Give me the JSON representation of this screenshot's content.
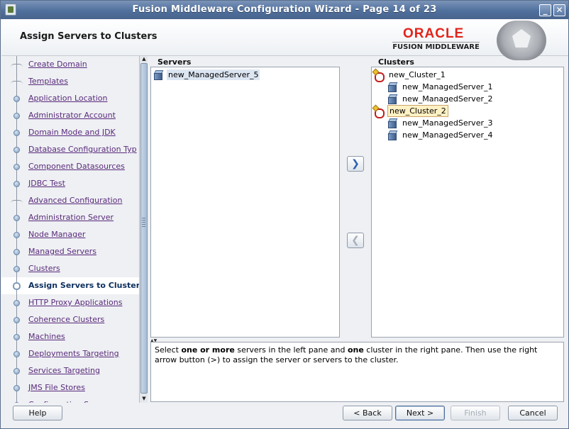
{
  "window": {
    "title": "Fusion Middleware Configuration Wizard - Page 14 of 23",
    "min_glyph": "_",
    "close_glyph": "✕"
  },
  "header": {
    "heading": "Assign Servers to Clusters",
    "brand_top": "ORACLE",
    "brand_bottom": "FUSION MIDDLEWARE"
  },
  "nav": {
    "items": [
      {
        "label": "Create Domain",
        "style": "flat"
      },
      {
        "label": "Templates",
        "style": "flat"
      },
      {
        "label": "Application Location",
        "style": "dot"
      },
      {
        "label": "Administrator Account",
        "style": "dot"
      },
      {
        "label": "Domain Mode and JDK",
        "style": "dot"
      },
      {
        "label": "Database Configuration Typ",
        "style": "dot"
      },
      {
        "label": "Component Datasources",
        "style": "dot"
      },
      {
        "label": "JDBC Test",
        "style": "dot"
      },
      {
        "label": "Advanced Configuration",
        "style": "flat"
      },
      {
        "label": "Administration Server",
        "style": "dot"
      },
      {
        "label": "Node Manager",
        "style": "dot"
      },
      {
        "label": "Managed Servers",
        "style": "dot"
      },
      {
        "label": "Clusters",
        "style": "dot"
      },
      {
        "label": "Assign Servers to Cluster",
        "style": "dot",
        "active": true
      },
      {
        "label": "HTTP Proxy Applications",
        "style": "dot"
      },
      {
        "label": "Coherence Clusters",
        "style": "dot"
      },
      {
        "label": "Machines",
        "style": "dot"
      },
      {
        "label": "Deployments Targeting",
        "style": "dot"
      },
      {
        "label": "Services Targeting",
        "style": "dot"
      },
      {
        "label": "JMS File Stores",
        "style": "dot"
      },
      {
        "label": "Configuration S",
        "style": "dot"
      }
    ]
  },
  "servers": {
    "heading": "Servers",
    "items": [
      "new_ManagedServer_5"
    ]
  },
  "clusters": {
    "heading": "Clusters",
    "tree": [
      {
        "name": "new_Cluster_1",
        "servers": [
          "new_ManagedServer_1",
          "new_ManagedServer_2"
        ]
      },
      {
        "name": "new_Cluster_2",
        "servers": [
          "new_ManagedServer_3",
          "new_ManagedServer_4"
        ]
      }
    ]
  },
  "controls": {
    "assign_glyph": "❯",
    "unassign_glyph": "❮"
  },
  "description": {
    "p1": "Select ",
    "b1": "one or more",
    "p2": " servers in the left pane and ",
    "b2": "one",
    "p3": " cluster in the right pane. Then use the right arrow button (>) to assign the server or servers to the cluster."
  },
  "buttons": {
    "help": "Help",
    "back": "< Back",
    "next": "Next >",
    "finish": "Finish",
    "cancel": "Cancel"
  }
}
